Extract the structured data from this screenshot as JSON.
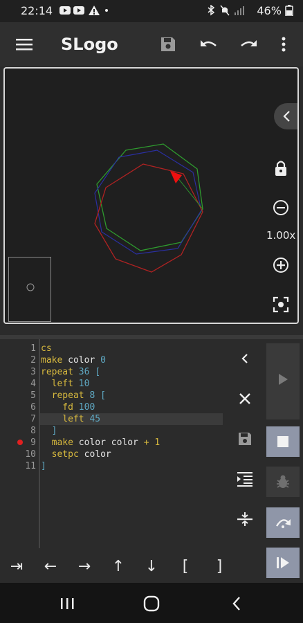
{
  "status_bar": {
    "time": "22:14",
    "battery": "46%"
  },
  "app_bar": {
    "title": "SLogo"
  },
  "canvas": {
    "zoom_label": "1.00x"
  },
  "editor": {
    "lines": [
      {
        "n": "1",
        "parts": [
          {
            "t": "cs",
            "c": "kw"
          }
        ]
      },
      {
        "n": "2",
        "parts": [
          {
            "t": "make",
            "c": "kw"
          },
          {
            "t": " color ",
            "c": "pl"
          },
          {
            "t": "0",
            "c": "num"
          }
        ]
      },
      {
        "n": "3",
        "parts": [
          {
            "t": "repeat",
            "c": "kw"
          },
          {
            "t": " 36 [",
            "c": "num"
          }
        ]
      },
      {
        "n": "4",
        "parts": [
          {
            "t": "  left",
            "c": "kw"
          },
          {
            "t": " 10",
            "c": "num"
          }
        ]
      },
      {
        "n": "5",
        "parts": [
          {
            "t": "  repeat",
            "c": "kw"
          },
          {
            "t": " 8 [",
            "c": "num"
          }
        ]
      },
      {
        "n": "6",
        "parts": [
          {
            "t": "    fd",
            "c": "kw"
          },
          {
            "t": " 100",
            "c": "num"
          }
        ]
      },
      {
        "n": "7",
        "parts": [
          {
            "t": "    left",
            "c": "kw"
          },
          {
            "t": " 45",
            "c": "num"
          }
        ]
      },
      {
        "n": "8",
        "parts": [
          {
            "t": "  ]",
            "c": "br"
          }
        ]
      },
      {
        "n": "9",
        "parts": [
          {
            "t": "  make",
            "c": "kw"
          },
          {
            "t": " color color ",
            "c": "pl"
          },
          {
            "t": "+ 1",
            "c": "kw"
          }
        ]
      },
      {
        "n": "10",
        "parts": [
          {
            "t": "  setpc",
            "c": "kw"
          },
          {
            "t": " color",
            "c": "pl"
          }
        ]
      },
      {
        "n": "11",
        "parts": [
          {
            "t": "]",
            "c": "br"
          }
        ]
      }
    ]
  },
  "keys": [
    "⇥",
    "←",
    "→",
    "↑",
    "↓",
    "[",
    "]"
  ]
}
